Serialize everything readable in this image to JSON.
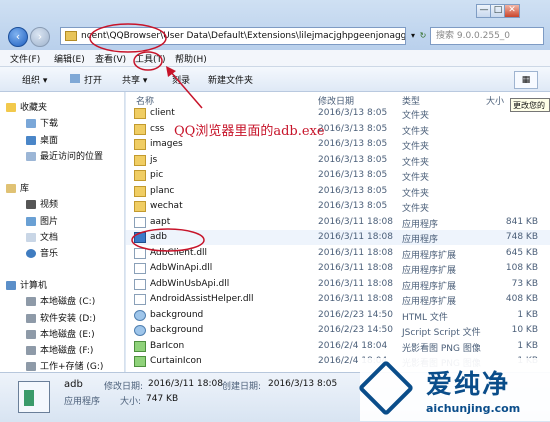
{
  "window": {
    "controls": [
      "—",
      "□",
      "✕"
    ]
  },
  "address": {
    "path": "ncent\\QQBrowser\\User Data\\Default\\Extensions\\lilejmacjghpgeenjonaggofc",
    "dropdown": "▾",
    "refresh": "↻",
    "search_placeholder": "搜索 9.0.0.255_0"
  },
  "menu": {
    "file": "文件(F)",
    "edit": "编辑(E)",
    "view": "查看(V)",
    "tools": "工具(T)",
    "help": "帮助(H)"
  },
  "toolbar": {
    "organize": "组织 ▾",
    "open": "打开",
    "share": "共享 ▾",
    "burn": "刻录",
    "new_folder": "新建文件夹"
  },
  "sidebar": {
    "favorites": "收藏夹",
    "downloads": "下载",
    "desktop": "桌面",
    "recent": "最近访问的位置",
    "library": "库",
    "videos": "视频",
    "pictures": "图片",
    "documents": "文档",
    "music": "音乐",
    "computer": "计算机",
    "drive_c": "本地磁盘 (C:)",
    "drive_d": "软件安装 (D:)",
    "drive_e": "本地磁盘 (E:)",
    "drive_f": "本地磁盘 (F:)",
    "drive_g": "工作+存储 (G:)"
  },
  "columns": {
    "name": "名称",
    "date": "修改日期",
    "type": "类型",
    "size": "大小"
  },
  "tooltip": "更改您的",
  "annotation": "QQ浏览器里面的adb.exe",
  "files": [
    {
      "name": "client",
      "date": "2016/3/13 8:05",
      "type": "文件夹",
      "size": "",
      "kind": "folder"
    },
    {
      "name": "css",
      "date": "2016/3/13 8:05",
      "type": "文件夹",
      "size": "",
      "kind": "folder"
    },
    {
      "name": "images",
      "date": "2016/3/13 8:05",
      "type": "文件夹",
      "size": "",
      "kind": "folder"
    },
    {
      "name": "js",
      "date": "2016/3/13 8:05",
      "type": "文件夹",
      "size": "",
      "kind": "folder"
    },
    {
      "name": "pic",
      "date": "2016/3/13 8:05",
      "type": "文件夹",
      "size": "",
      "kind": "folder"
    },
    {
      "name": "planc",
      "date": "2016/3/13 8:05",
      "type": "文件夹",
      "size": "",
      "kind": "folder"
    },
    {
      "name": "wechat",
      "date": "2016/3/13 8:05",
      "type": "文件夹",
      "size": "",
      "kind": "folder"
    },
    {
      "name": "aapt",
      "date": "2016/3/11 18:08",
      "type": "应用程序",
      "size": "841 KB",
      "kind": "file"
    },
    {
      "name": "adb",
      "date": "2016/3/11 18:08",
      "type": "应用程序",
      "size": "748 KB",
      "kind": "app"
    },
    {
      "name": "AdbClient.dll",
      "date": "2016/3/11 18:08",
      "type": "应用程序扩展",
      "size": "645 KB",
      "kind": "file"
    },
    {
      "name": "AdbWinApi.dll",
      "date": "2016/3/11 18:08",
      "type": "应用程序扩展",
      "size": "108 KB",
      "kind": "file"
    },
    {
      "name": "AdbWinUsbApi.dll",
      "date": "2016/3/11 18:08",
      "type": "应用程序扩展",
      "size": "73 KB",
      "kind": "file"
    },
    {
      "name": "AndroidAssistHelper.dll",
      "date": "2016/3/11 18:08",
      "type": "应用程序扩展",
      "size": "408 KB",
      "kind": "file"
    },
    {
      "name": "background",
      "date": "2016/2/23 14:50",
      "type": "HTML 文件",
      "size": "1 KB",
      "kind": "script"
    },
    {
      "name": "background",
      "date": "2016/2/23 14:50",
      "type": "JScript Script 文件",
      "size": "10 KB",
      "kind": "script"
    },
    {
      "name": "BarIcon",
      "date": "2016/2/4 18:04",
      "type": "光影看图 PNG 图像",
      "size": "1 KB",
      "kind": "png"
    },
    {
      "name": "CurtainIcon",
      "date": "2016/2/4 18:04",
      "type": "光影看图 PNG 图像",
      "size": "1 KB",
      "kind": "png"
    }
  ],
  "details": {
    "name": "adb",
    "modified_label": "修改日期:",
    "modified": "2016/3/11 18:08",
    "created_label": "创建日期:",
    "created": "2016/3/13 8:05",
    "type": "应用程序",
    "size_label": "大小:",
    "size": "747 KB"
  },
  "watermark": {
    "brand": "爱纯净",
    "url": "aichunjing.com"
  },
  "colors": {
    "annotation_red": "#c7142a",
    "brand_blue": "#0a4d8a"
  }
}
